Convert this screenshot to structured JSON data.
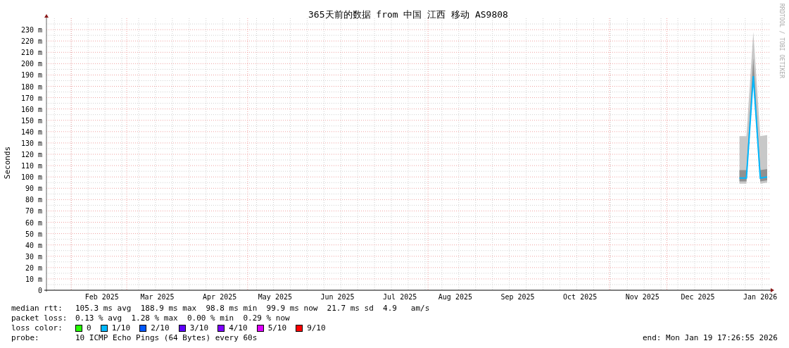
{
  "chart": {
    "credit": "RRDTOOL / TOBI OETIKER",
    "chart_data": {
      "type": "line",
      "title": "365天前的数据 from 中国 江西 移动 AS9808",
      "ylabel": "Seconds",
      "ylim": [
        0,
        240
      ],
      "grid": true,
      "categories": [
        null,
        null,
        null,
        null,
        null,
        null,
        null,
        null,
        "Feb 2025",
        null,
        null,
        null,
        null,
        null,
        null,
        null,
        "Mar 2025",
        null,
        null,
        null,
        null,
        null,
        null,
        null,
        null,
        "Apr 2025",
        null,
        null,
        null,
        null,
        null,
        null,
        null,
        "May 2025",
        null,
        null,
        null,
        null,
        null,
        null,
        null,
        null,
        "Jun 2025",
        null,
        null,
        null,
        null,
        null,
        null,
        null,
        null,
        "Jul 2025",
        null,
        null,
        null,
        null,
        null,
        null,
        null,
        "Aug 2025",
        null,
        null,
        null,
        null,
        null,
        null,
        null,
        null,
        "Sep 2025",
        null,
        null,
        null,
        null,
        null,
        null,
        null,
        null,
        "Oct 2025",
        null,
        null,
        null,
        null,
        null,
        null,
        null,
        null,
        "Nov 2025",
        null,
        null,
        null,
        null,
        null,
        null,
        null,
        "Dec 2025",
        null,
        null,
        null,
        null,
        null,
        null,
        null,
        null,
        "Jan 2026",
        null
      ],
      "yticks": [
        {
          "value": 0,
          "label": "0"
        },
        {
          "value": 10,
          "label": "10 m"
        },
        {
          "value": 20,
          "label": "20 m"
        },
        {
          "value": 30,
          "label": "30 m"
        },
        {
          "value": 40,
          "label": "40 m"
        },
        {
          "value": 50,
          "label": "50 m"
        },
        {
          "value": 60,
          "label": "60 m"
        },
        {
          "value": 70,
          "label": "70 m"
        },
        {
          "value": 80,
          "label": "80 m"
        },
        {
          "value": 90,
          "label": "90 m"
        },
        {
          "value": 100,
          "label": "100 m"
        },
        {
          "value": 110,
          "label": "110 m"
        },
        {
          "value": 120,
          "label": "120 m"
        },
        {
          "value": 130,
          "label": "130 m"
        },
        {
          "value": 140,
          "label": "140 m"
        },
        {
          "value": 150,
          "label": "150 m"
        },
        {
          "value": 160,
          "label": "160 m"
        },
        {
          "value": 170,
          "label": "170 m"
        },
        {
          "value": 180,
          "label": "180 m"
        },
        {
          "value": 190,
          "label": "190 m"
        },
        {
          "value": 200,
          "label": "200 m"
        },
        {
          "value": 210,
          "label": "210 m"
        },
        {
          "value": 220,
          "label": "220 m"
        },
        {
          "value": 230,
          "label": "230 m"
        }
      ],
      "series": [
        {
          "color": "#00b8ff",
          "values": [
            null,
            null,
            null,
            null,
            null,
            null,
            null,
            null,
            null,
            null,
            null,
            null,
            null,
            null,
            null,
            null,
            null,
            null,
            null,
            null,
            null,
            null,
            null,
            null,
            null,
            null,
            null,
            null,
            null,
            null,
            null,
            null,
            null,
            null,
            null,
            null,
            null,
            null,
            null,
            null,
            null,
            null,
            null,
            null,
            null,
            null,
            null,
            null,
            null,
            null,
            null,
            null,
            null,
            null,
            null,
            null,
            null,
            null,
            null,
            null,
            null,
            null,
            null,
            null,
            null,
            null,
            null,
            null,
            null,
            null,
            null,
            null,
            null,
            null,
            null,
            null,
            null,
            null,
            null,
            null,
            null,
            null,
            null,
            null,
            null,
            null,
            null,
            null,
            null,
            null,
            null,
            null,
            null,
            null,
            null,
            null,
            null,
            null,
            null,
            null,
            99,
            99,
            189,
            99,
            100
          ]
        }
      ]
    }
  },
  "legend": [
    {
      "kind": "stats",
      "label": "median rtt:",
      "text": "105.3 ms avg  188.9 ms max  98.8 ms min  99.9 ms now  21.7 ms sd  4.9   am/s"
    },
    {
      "kind": "stats",
      "label": "packet loss:",
      "text": "0.13 % avg  1.28 % max  0.00 % min  0.29 % now"
    },
    {
      "kind": "colors",
      "label": "loss color:",
      "items": [
        {
          "label": "0",
          "color": "#26ff00"
        },
        {
          "label": "1/10",
          "color": "#00b8ff"
        },
        {
          "label": "2/10",
          "color": "#0059ff"
        },
        {
          "label": "3/10",
          "color": "#5e00ff"
        },
        {
          "label": "4/10",
          "color": "#7e00ff"
        },
        {
          "label": "5/10",
          "color": "#dd00ff"
        },
        {
          "label": "9/10",
          "color": "#ff0000"
        }
      ]
    },
    {
      "kind": "probe",
      "label": "probe:",
      "text": "10 ICMP Echo Pings (64 Bytes) every 60s",
      "end": "end: Mon Jan 19 17:26:55 2026"
    }
  ]
}
